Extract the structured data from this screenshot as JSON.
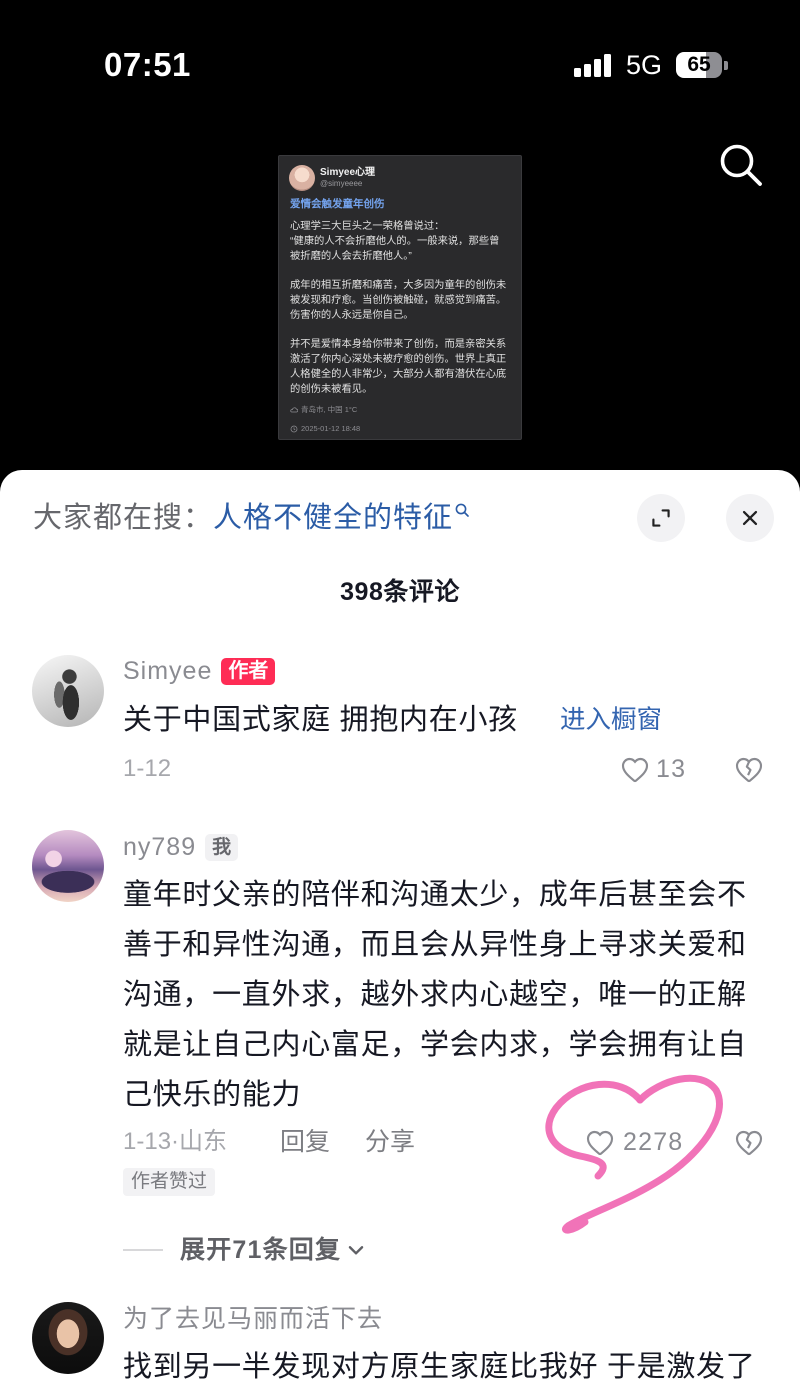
{
  "status_bar": {
    "time": "07:51",
    "network": "5G",
    "battery": "65"
  },
  "icons": {
    "top_search": "search-icon",
    "suggestion_search": "search-icon",
    "expand": "expand-icon",
    "close": "close-icon",
    "like": "heart-icon",
    "dislike": "broken-heart-icon",
    "expand_replies": "chevron-down-icon",
    "post_location": "location-icon",
    "post_time": "clock-icon"
  },
  "colors": {
    "brand_red": "#fe2c55",
    "link_blue": "#2b5ca6",
    "annotation_pink": "#f06cb4",
    "text_primary": "#161823",
    "text_secondary": "#8a8b91"
  },
  "post_card": {
    "author_name": "Simyee心理",
    "author_handle": "@simyeeee",
    "title": "爱情会触发童年创伤",
    "paragraphs": [
      [
        "心理学三大巨头之一荣格曾说过：",
        "“健康的人不会折磨他人的。一般来说，那些曾",
        "被折磨的人会去折磨他人。”"
      ],
      [
        "成年的相互折磨和痛苦，大多因为童年的创伤未",
        "被发现和疗愈。当创伤被触碰，就感觉到痛苦。",
        "伤害你的人永远是你自己。"
      ],
      [
        "并不是爱情本身给你带来了创伤，而是亲密关系",
        "激活了你内心深处未被疗愈的创伤。世界上真正",
        "人格健全的人非常少，大部分人都有潜伏在心底",
        "的创伤未被看见。"
      ]
    ],
    "location": "青岛市, 中国 1°C",
    "timestamp": "2025-01-12 18:48"
  },
  "comments_panel": {
    "search_prompt_label": "大家都在搜：",
    "search_suggestion": "人格不健全的特征",
    "comment_count_label": "398条评论",
    "comments": [
      {
        "user": "Simyee",
        "badge": "作者",
        "text": "关于中国式家庭 拥抱内在小孩",
        "link": "进入橱窗",
        "date": "1-12",
        "likes": "13"
      },
      {
        "user": "ny789",
        "badge": "我",
        "text": "童年时父亲的陪伴和沟通太少，成年后甚至会不善于和异性沟通，而且会从异性身上寻求关爱和沟通，一直外求，越外求内心越空，唯一的正解就是让自己内心富足，学会内求，学会拥有让自己快乐的能力",
        "date_location": "1-13·山东",
        "reply_label": "回复",
        "share_label": "分享",
        "likes": "2278",
        "author_liked_badge": "作者赞过",
        "expand_replies_label": "展开71条回复"
      },
      {
        "user": "为了去见马丽而活下去",
        "text": "找到另一半发现对方原生家庭比我好 于是激发了"
      }
    ]
  }
}
